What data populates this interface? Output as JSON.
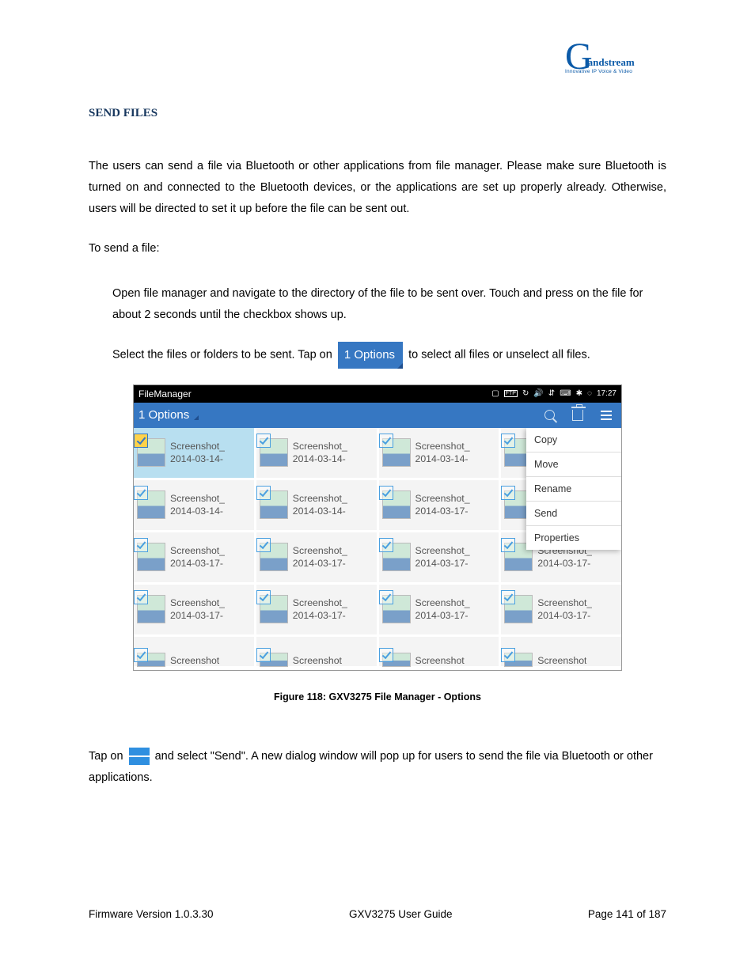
{
  "logo": {
    "brand": "andstream",
    "tagline": "Innovative IP Voice & Video"
  },
  "section_title": "SEND FILES",
  "intro": "The users can send a file via Bluetooth or other applications from file manager. Please make sure Bluetooth is turned on and connected to the Bluetooth devices, or the applications are set up properly already. Otherwise, users will be directed to set it up before the file can be sent out.",
  "lead_in": "To send a file:",
  "step1": "Open file manager and navigate to the directory of the file to be sent over. Touch and press on the file for about 2 seconds until the checkbox shows up.",
  "step2a": "Select the files or folders to be sent. Tap on ",
  "options_chip": "1 Options",
  "step2b": " to select all files or unselect all files.",
  "screenshot": {
    "app_title": "FileManager",
    "status_time": "17:27",
    "toolbar_label": "1 Options",
    "rows": [
      [
        {
          "l1": "Screenshot_",
          "l2": "2014-03-14-",
          "sel": true
        },
        {
          "l1": "Screenshot_",
          "l2": "2014-03-14-"
        },
        {
          "l1": "Screenshot_",
          "l2": "2014-03-14-"
        },
        {
          "l1": "",
          "l2": ""
        }
      ],
      [
        {
          "l1": "Screenshot_",
          "l2": "2014-03-14-"
        },
        {
          "l1": "Screenshot_",
          "l2": "2014-03-14-"
        },
        {
          "l1": "Screenshot_",
          "l2": "2014-03-17-"
        },
        {
          "l1": "",
          "l2": ""
        }
      ],
      [
        {
          "l1": "Screenshot_",
          "l2": "2014-03-17-"
        },
        {
          "l1": "Screenshot_",
          "l2": "2014-03-17-"
        },
        {
          "l1": "Screenshot_",
          "l2": "2014-03-17-"
        },
        {
          "l1": "Screenshot_",
          "l2": "2014-03-17-"
        }
      ],
      [
        {
          "l1": "Screenshot_",
          "l2": "2014-03-17-"
        },
        {
          "l1": "Screenshot_",
          "l2": "2014-03-17-"
        },
        {
          "l1": "Screenshot_",
          "l2": "2014-03-17-"
        },
        {
          "l1": "Screenshot_",
          "l2": "2014-03-17-"
        }
      ],
      [
        {
          "l1": "Screenshot",
          "l2": ""
        },
        {
          "l1": "Screenshot",
          "l2": ""
        },
        {
          "l1": "Screenshot",
          "l2": ""
        },
        {
          "l1": "Screenshot",
          "l2": ""
        }
      ]
    ],
    "context_menu": [
      "Copy",
      "Move",
      "Rename",
      "Send",
      "Properties"
    ]
  },
  "figure_caption": "Figure 118: GXV3275 File Manager - Options",
  "step3a": "Tap on ",
  "step3b": " and select \"Send\". A new dialog window will pop up for users to send the file via Bluetooth or other applications.",
  "footer": {
    "left": "Firmware Version 1.0.3.30",
    "center": "GXV3275 User Guide",
    "right": "Page 141 of 187"
  }
}
